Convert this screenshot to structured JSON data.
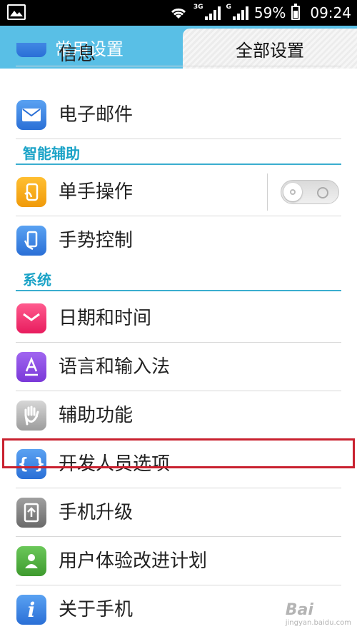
{
  "status_bar": {
    "net_3g": "3G",
    "net_g": "G",
    "battery": "59%",
    "time": "09:24"
  },
  "tabs": [
    {
      "label": "常用设置",
      "active": false
    },
    {
      "label": "全部设置",
      "active": true
    }
  ],
  "items": {
    "partial_top": "信息",
    "email": "电子邮件",
    "section_assist": "智能辅助",
    "one_hand": "单手操作",
    "gesture": "手势控制",
    "section_system": "系统",
    "date_time": "日期和时间",
    "language": "语言和输入法",
    "accessibility": "辅助功能",
    "developer": "开发人员选项",
    "upgrade": "手机升级",
    "ux_program": "用户体验改进计划",
    "about": "关于手机"
  },
  "toggle_one_hand": {
    "on": false
  },
  "watermark": {
    "text": "Bai",
    "sub": "jingyan.baidu.com"
  },
  "colors": {
    "tab_bar": "#59bfe6",
    "section_accent": "#1ba3c7",
    "highlight": "#c9212f"
  }
}
